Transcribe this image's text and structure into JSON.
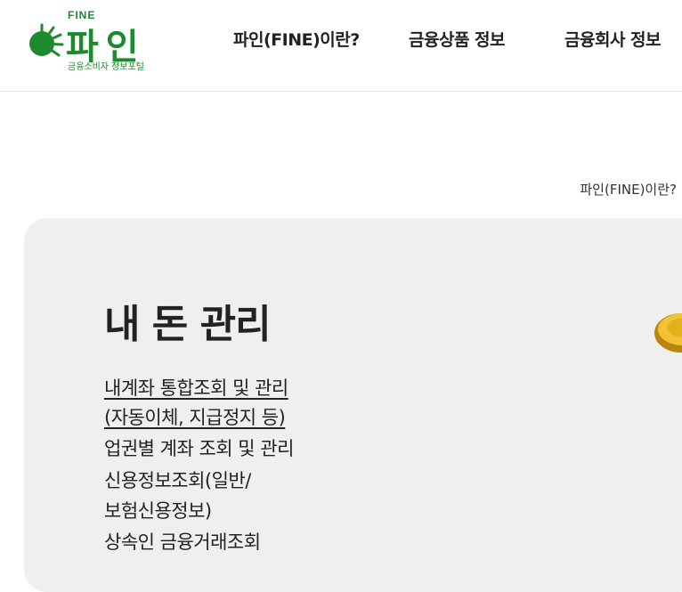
{
  "logo": {
    "fine_label": "FINE",
    "name": "파인",
    "subtitle": "금융소비자 정보포털"
  },
  "nav": {
    "items": [
      "파인(FINE)이란?",
      "금융상품 정보",
      "금융회사 정보"
    ]
  },
  "breadcrumb": "파인(FINE)이란?",
  "panel": {
    "title": "내 돈 관리",
    "items": [
      "내계좌 통합조회 및 관리",
      "(자동이체, 지급정지 등)",
      "업권별 계좌 조회 및 관리",
      "신용정보조회(일반/",
      "보험신용정보)",
      "상속인 금융거래조회"
    ]
  },
  "colors": {
    "brand_green": "#1e8a2e",
    "panel_bg": "#eff0ee",
    "coin_gold": "#e2b21c"
  }
}
